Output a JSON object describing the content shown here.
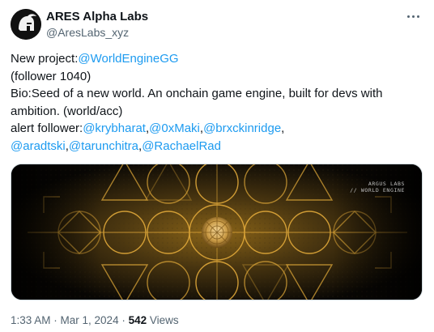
{
  "author": {
    "name": "ARES Alpha Labs",
    "handle": "@AresLabs_xyz",
    "avatar_icon": "spartan-helmet-icon"
  },
  "more_icon": "ellipsis-icon",
  "tweet": {
    "line1_prefix": "New project:",
    "line1_mention": "@WorldEngineGG",
    "line2": "(follower 1040)",
    "line3": "Bio:Seed of a new world. An onchain game engine, built for devs with",
    "line4": "ambition. (world/acc)",
    "line5_prefix": "alert follower:",
    "mentions_row1": [
      "@krybharat",
      "@0xMaki",
      "@brxckinridge"
    ],
    "mentions_row2": [
      "@aradtski",
      "@tarunchitra",
      "@RachaelRad"
    ],
    "separator": ",",
    "trailing_comma": ","
  },
  "media": {
    "overlay_line1": "ARGUS LABS",
    "overlay_line2": "// WORLD ENGINE",
    "accent": "#e0a93a"
  },
  "meta": {
    "time": "1:33 AM",
    "sep": " · ",
    "date": "Mar 1, 2024",
    "views_count": "542",
    "views_label": " Views"
  }
}
